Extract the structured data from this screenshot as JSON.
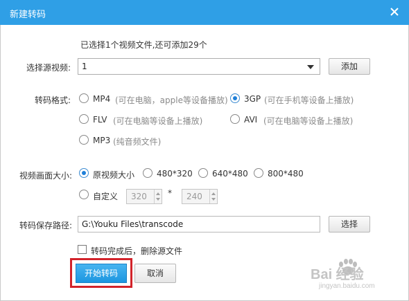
{
  "dialog": {
    "title": "新建转码",
    "close_icon": "close-icon",
    "title_bar_color": "#2f9fe6"
  },
  "selection_info": "已选择1个视频文件,还可添加29个",
  "source": {
    "label": "选择源视频:",
    "selected": "1",
    "add_button": "添加"
  },
  "format": {
    "label": "转码格式:",
    "options": [
      {
        "name": "MP4",
        "hint": "(可在电脑，apple等设备播放)",
        "checked": false
      },
      {
        "name": "3GP",
        "hint": "(可在手机等设备上播放)",
        "checked": true
      },
      {
        "name": "FLV",
        "hint": "(可在电脑等设备上播放)",
        "checked": false
      },
      {
        "name": "AVI",
        "hint": "(可在电脑等设备上播放)",
        "checked": false
      },
      {
        "name": "MP3",
        "hint": "(纯音频文件)",
        "checked": false
      }
    ]
  },
  "size": {
    "label": "视频画面大小:",
    "options": [
      {
        "name": "原视频大小",
        "checked": true
      },
      {
        "name": "480*320",
        "checked": false
      },
      {
        "name": "640*480",
        "checked": false
      },
      {
        "name": "800*480",
        "checked": false
      }
    ],
    "custom": {
      "label": "自定义",
      "width": "320",
      "separator": "*",
      "height": "240",
      "checked": false
    }
  },
  "output": {
    "label": "转码保存路径:",
    "path": "G:\\Youku Files\\transcode",
    "choose_button": "选择"
  },
  "delete_source": {
    "label": "转码完成后，删除源文件",
    "checked": false
  },
  "actions": {
    "start_button": "开始转码",
    "cancel_button": "取消",
    "accent_color": "#2f9fe6",
    "highlight_color": "#d2232a"
  },
  "watermark": {
    "text": "Bai 经验",
    "subtext": "jingyan.baidu.com"
  }
}
